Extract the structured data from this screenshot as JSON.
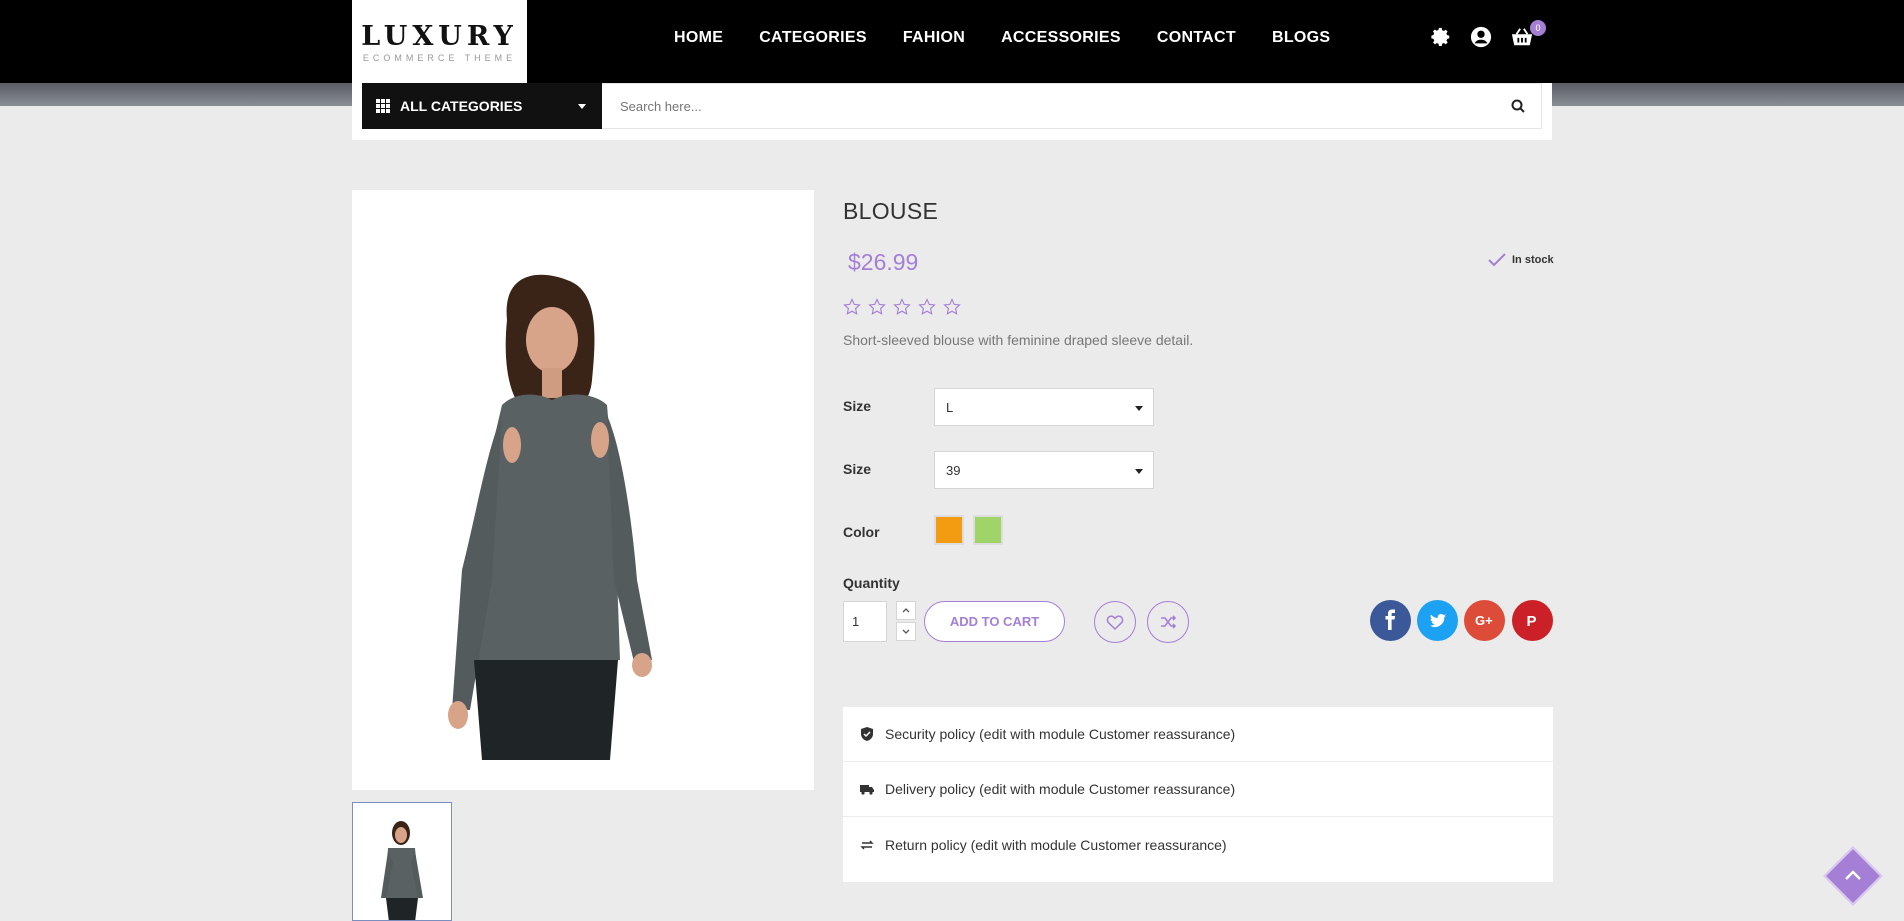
{
  "header": {
    "logo_main": "LUXURY",
    "logo_sub": "ECOMMERCE THEME",
    "nav": [
      "HOME",
      "CATEGORIES",
      "FAHION",
      "ACCESSORIES",
      "CONTACT",
      "BLOGS"
    ],
    "cart_count": "0",
    "icons": [
      "gear-icon",
      "user-icon",
      "basket-icon"
    ]
  },
  "search": {
    "categories_label": "ALL CATEGORIES",
    "placeholder": "Search here..."
  },
  "product": {
    "name": "BLOUSE",
    "price": "$26.99",
    "stock": "In stock",
    "rating": 0,
    "description": "Short-sleeved blouse with feminine draped sleeve detail.",
    "size1_label": "Size",
    "size1_value": "L",
    "size2_label": "Size",
    "size2_value": "39",
    "color_label": "Color",
    "colors": [
      "#f39c12",
      "#a0d468"
    ],
    "quantity_label": "Quantity",
    "quantity": "1",
    "add_to_cart": "ADD TO CART"
  },
  "social": {
    "facebook": "f",
    "twitter": "twitter-icon",
    "google": "G+",
    "pinterest": "P",
    "colors": [
      "#3b5998",
      "#1da1f2",
      "#dd4b39",
      "#cb2027"
    ]
  },
  "reassurance": [
    "Security policy (edit with module Customer reassurance)",
    "Delivery policy (edit with module Customer reassurance)",
    "Return policy (edit with module Customer reassurance)"
  ],
  "accent": "#a57fd6"
}
